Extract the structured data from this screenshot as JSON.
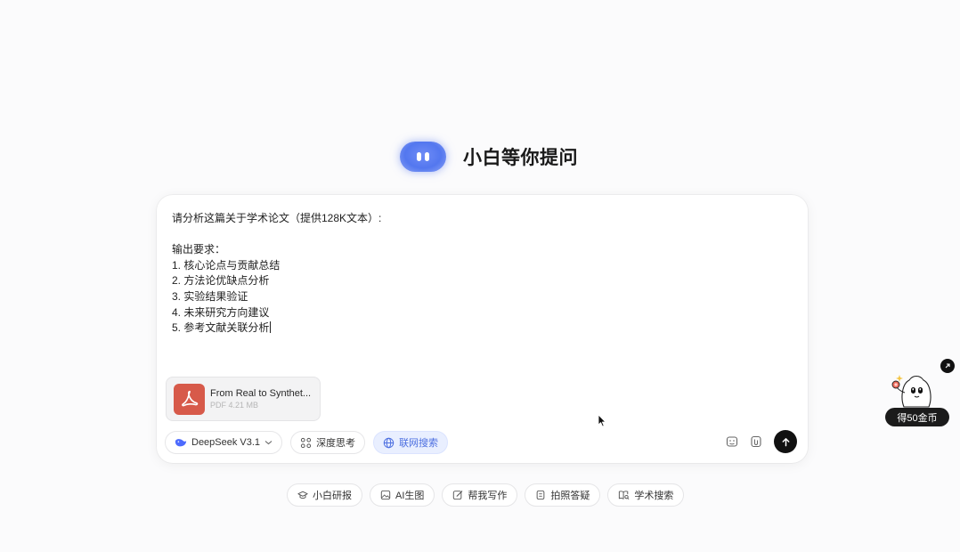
{
  "hero": {
    "title": "小白等你提问"
  },
  "composer": {
    "prompt_lines": [
      "请分析这篇关于学术论文（提供128K文本）:",
      "",
      "输出要求：",
      "1. 核心论点与贡献总结",
      "2. 方法论优缺点分析",
      "3. 实验结果验证",
      "4. 未来研究方向建议",
      "5. 参考文献关联分析"
    ],
    "attachment": {
      "name": "From Real to Synthet...",
      "size": "PDF 4.21 MB",
      "icon": "pdf-icon"
    },
    "toolbar": {
      "model_label": "DeepSeek V3.1",
      "deep_think_label": "深度思考",
      "web_search_label": "联网搜索"
    },
    "accent_color": "#4d6fe0"
  },
  "quick_actions": [
    {
      "label": "小白研报",
      "icon": "graduation-cap-icon"
    },
    {
      "label": "AI生图",
      "icon": "image-icon"
    },
    {
      "label": "帮我写作",
      "icon": "edit-icon"
    },
    {
      "label": "拍照答疑",
      "icon": "document-icon"
    },
    {
      "label": "学术搜索",
      "icon": "book-search-icon"
    }
  ],
  "reward": {
    "label": "得50金币"
  }
}
